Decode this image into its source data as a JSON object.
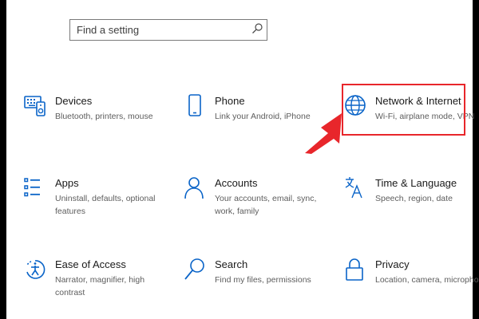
{
  "search": {
    "placeholder": "Find a setting"
  },
  "colors": {
    "icon_accent": "#0a64c8",
    "highlight": "#e8262b"
  },
  "tiles": [
    {
      "title": "Devices",
      "description": "Bluetooth, printers, mouse",
      "icon": "devices-icon"
    },
    {
      "title": "Phone",
      "description": "Link your Android, iPhone",
      "icon": "phone-icon"
    },
    {
      "title": "Network & Internet",
      "description": "Wi-Fi, airplane mode, VPN",
      "icon": "globe-icon"
    },
    {
      "title": "Apps",
      "description": "Uninstall, defaults, optional features",
      "icon": "apps-list-icon"
    },
    {
      "title": "Accounts",
      "description": "Your accounts, email, sync, work, family",
      "icon": "person-icon"
    },
    {
      "title": "Time & Language",
      "description": "Speech, region, date",
      "icon": "time-language-icon"
    },
    {
      "title": "Ease of Access",
      "description": "Narrator, magnifier, high contrast",
      "icon": "ease-of-access-icon"
    },
    {
      "title": "Search",
      "description": "Find my files, permissions",
      "icon": "magnifier-icon"
    },
    {
      "title": "Privacy",
      "description": "Location, camera, microphone",
      "icon": "lock-icon"
    }
  ],
  "annotation": {
    "highlighted_tile": "Network & Internet",
    "pointer": "red-arrow"
  }
}
